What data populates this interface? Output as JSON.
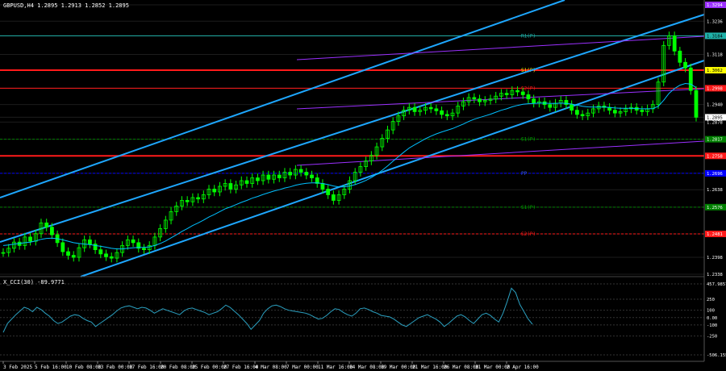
{
  "header": {
    "symbol_line": "GBPUSD,H4  1.2895 1.2913 1.2852 1.2895",
    "cci_line": "X_CCI(30) -89.9771"
  },
  "chart_data": {
    "type": "candlestick",
    "symbol": "GBPUSD",
    "timeframe": "H4",
    "ohlc_current": {
      "open": 1.2895,
      "high": 1.2913,
      "low": 1.2852,
      "close": 1.2895
    },
    "x_tick_labels": [
      "3 Feb 2025",
      "5 Feb 16:00",
      "10 Feb 08:00",
      "13 Feb 00:00",
      "17 Feb 16:00",
      "20 Feb 08:00",
      "25 Feb 00:00",
      "27 Feb 16:00",
      "4 Mar 08:00",
      "7 Mar 00:00",
      "11 Mar 16:00",
      "14 Mar 08:00",
      "19 Mar 00:00",
      "21 Mar 16:00",
      "26 Mar 08:00",
      "31 Mar 00:00",
      "2 Apr 16:00"
    ],
    "y_tick_labels": [
      "1.3294",
      "1.3236",
      "1.3184",
      "1.3118",
      "1.3062",
      "1.2998",
      "1.2940",
      "1.2895",
      "1.2878",
      "1.2817",
      "1.2758",
      "1.2696",
      "1.2638",
      "1.2576",
      "1.2481",
      "1.2398",
      "1.2338"
    ],
    "ylim": [
      1.2338,
      1.3294
    ],
    "series_close": [
      1.2415,
      1.243,
      1.2452,
      1.244,
      1.247,
      1.2455,
      1.2482,
      1.252,
      1.2505,
      1.2478,
      1.245,
      1.2418,
      1.2405,
      1.2398,
      1.2432,
      1.246,
      1.2445,
      1.2425,
      1.241,
      1.24,
      1.2395,
      1.2415,
      1.244,
      1.246,
      1.245,
      1.243,
      1.2425,
      1.244,
      1.247,
      1.25,
      1.253,
      1.256,
      1.258,
      1.26,
      1.2595,
      1.261,
      1.2605,
      1.262,
      1.264,
      1.263,
      1.265,
      1.266,
      1.264,
      1.2655,
      1.267,
      1.266,
      1.268,
      1.267,
      1.269,
      1.2675,
      1.269,
      1.268,
      1.27,
      1.269,
      1.271,
      1.27,
      1.269,
      1.268,
      1.266,
      1.264,
      1.262,
      1.26,
      1.262,
      1.264,
      1.267,
      1.27,
      1.272,
      1.274,
      1.276,
      1.279,
      1.282,
      1.285,
      1.288,
      1.29,
      1.292,
      1.293,
      1.2915,
      1.292,
      1.293,
      1.2925,
      1.2918,
      1.2905,
      1.29,
      1.291,
      1.2935,
      1.295,
      1.2965,
      1.296,
      1.295,
      1.2955,
      1.296,
      1.297,
      1.298,
      1.2975,
      1.299,
      1.2985,
      1.2975,
      1.296,
      1.2945,
      1.295,
      1.294,
      1.293,
      1.2945,
      1.2955,
      1.294,
      1.292,
      1.2905,
      1.29,
      1.291,
      1.2925,
      1.2935,
      1.293,
      1.292,
      1.291,
      1.2915,
      1.2925,
      1.293,
      1.292,
      1.2915,
      1.2925,
      1.294,
      1.302,
      1.315,
      1.3184,
      1.313,
      1.309,
      1.307,
      1.299,
      1.2895
    ],
    "moving_average": [
      1.244,
      1.2442,
      1.2445,
      1.2447,
      1.245,
      1.2452,
      1.2456,
      1.2462,
      1.2465,
      1.2466,
      1.2464,
      1.246,
      1.2455,
      1.245,
      1.2447,
      1.2445,
      1.2443,
      1.244,
      1.2437,
      1.2434,
      1.243,
      1.2428,
      1.2428,
      1.243,
      1.2432,
      1.2433,
      1.2433,
      1.2435,
      1.244,
      1.2447,
      1.2456,
      1.2467,
      1.2478,
      1.249,
      1.25,
      1.2511,
      1.252,
      1.253,
      1.2541,
      1.255,
      1.256,
      1.257,
      1.2577,
      1.2585,
      1.2593,
      1.26,
      1.2608,
      1.2614,
      1.2621,
      1.2627,
      1.2633,
      1.2638,
      1.2644,
      1.2648,
      1.2654,
      1.2658,
      1.2661,
      1.2662,
      1.2662,
      1.266,
      1.2656,
      1.2651,
      1.2648,
      1.2648,
      1.2651,
      1.2656,
      1.2663,
      1.2671,
      1.2681,
      1.2693,
      1.2707,
      1.2722,
      1.2739,
      1.2755,
      1.2771,
      1.2786,
      1.2797,
      1.2808,
      1.2819,
      1.2828,
      1.2836,
      1.2843,
      1.2849,
      1.2855,
      1.2863,
      1.2871,
      1.288,
      1.2888,
      1.2894,
      1.29,
      1.2906,
      1.2913,
      1.292,
      1.2925,
      1.2932,
      1.2937,
      1.2941,
      1.2943,
      1.2944,
      1.2945,
      1.2945,
      1.2944,
      1.2944,
      1.2945,
      1.2944,
      1.2942,
      1.2938,
      1.2934,
      1.2932,
      1.2931,
      1.2931,
      1.2931,
      1.293,
      1.2928,
      1.2927,
      1.2927,
      1.2927,
      1.2926,
      1.2925,
      1.2925,
      1.2926,
      1.2934,
      1.2955,
      1.298,
      1.2997,
      1.3009,
      1.3015,
      1.3013,
      1.3
    ],
    "horizontal_levels": [
      {
        "price": 1.3184,
        "label": "R1(P)"
      },
      {
        "price": 1.3062,
        "label": "S1(P)"
      },
      {
        "price": 1.2998,
        "label": "S2(P)"
      },
      {
        "price": 1.2817,
        "label": "S1(P)"
      },
      {
        "price": 1.2758,
        "label": ""
      },
      {
        "price": 1.2696,
        "label": "PP"
      },
      {
        "price": 1.2576,
        "label": "S1(P)"
      },
      {
        "price": 1.2481,
        "label": "S2(P)"
      }
    ],
    "indicator": {
      "name": "X_CCI(30)",
      "value": -89.9771,
      "ylim": [
        -506.1558,
        457.9857
      ],
      "y_tick_labels": [
        "457.9857",
        "250",
        "100",
        "0.00",
        "-100",
        "-250",
        "-506.1558"
      ],
      "values": [
        -200,
        -80,
        -20,
        40,
        90,
        140,
        120,
        80,
        140,
        110,
        60,
        20,
        -40,
        -80,
        -60,
        -20,
        20,
        40,
        30,
        -10,
        -40,
        -60,
        -120,
        -80,
        -40,
        0,
        40,
        90,
        130,
        150,
        160,
        140,
        120,
        140,
        130,
        100,
        60,
        90,
        120,
        100,
        80,
        60,
        40,
        90,
        120,
        130,
        110,
        90,
        70,
        40,
        60,
        80,
        120,
        170,
        140,
        90,
        40,
        -20,
        -80,
        -160,
        -100,
        -40,
        60,
        120,
        160,
        170,
        150,
        120,
        100,
        90,
        80,
        70,
        60,
        40,
        10,
        -20,
        -10,
        30,
        80,
        120,
        110,
        70,
        40,
        20,
        60,
        120,
        130,
        110,
        80,
        60,
        30,
        20,
        10,
        -20,
        -60,
        -100,
        -120,
        -80,
        -40,
        0,
        20,
        40,
        10,
        -20,
        -60,
        -120,
        -80,
        -30,
        20,
        40,
        10,
        -40,
        -80,
        -20,
        40,
        60,
        30,
        -20,
        -60,
        60,
        220,
        400,
        340,
        180,
        80,
        -20,
        -90
      ]
    },
    "colors": {
      "background": "#000000",
      "candle_up": "#00ff00",
      "candle_down": "#00ff00",
      "moving_average": "#00bfff",
      "channel_lines": "#1ea7ff",
      "trend_lines": "#9b30ff",
      "resistance": "#ff1a1a",
      "support_dashed": "#008000",
      "pivot": "#0000ff",
      "grid": "#1c1c1c",
      "cci_line": "#2ba0c0"
    }
  }
}
